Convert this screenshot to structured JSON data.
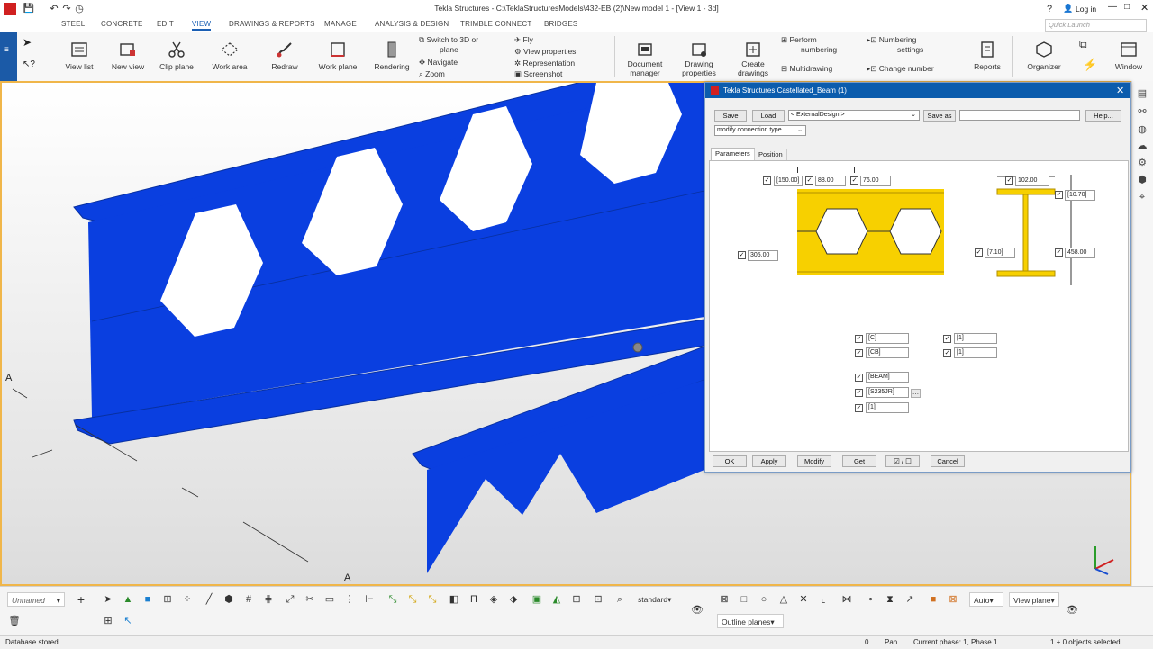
{
  "window": {
    "title": "Tekla Structures - C:\\TeklaStructuresModels\\432-EB (2)\\New model 1  - [View 1 - 3d]",
    "login": "Log in",
    "quick_launch_placeholder": "Quick Launch"
  },
  "menu": [
    "STEEL",
    "CONCRETE",
    "EDIT",
    "VIEW",
    "DRAWINGS & REPORTS",
    "MANAGE",
    "ANALYSIS & DESIGN",
    "TRIMBLE CONNECT",
    "BRIDGES"
  ],
  "ribbon": {
    "view_list": "View list",
    "new_view": "New view",
    "clip_plane": "Clip plane",
    "work_area": "Work area",
    "redraw": "Redraw",
    "work_plane": "Work plane",
    "rendering": "Rendering",
    "switch_3d": "Switch to 3D or",
    "switch_3d_2": "plane",
    "navigate": "Navigate",
    "zoom": "Zoom",
    "fly": "Fly",
    "view_properties": "View properties",
    "representation": "Representation",
    "screenshot": "Screenshot",
    "document_manager": "Document",
    "document_manager_2": "manager",
    "drawing_properties": "Drawing",
    "drawing_properties_2": "properties",
    "create_drawings": "Create",
    "create_drawings_2": "drawings",
    "perform_numbering": "Perform",
    "perform_numbering_2": "numbering",
    "multidrawing": "Multidrawing",
    "numbering_settings": "Numbering",
    "numbering_settings_2": "settings",
    "change_number": "Change number",
    "reports": "Reports",
    "organizer": "Organizer",
    "window": "Window"
  },
  "viewport": {
    "gridlabel_a1": "A",
    "gridlabel_a2": "A"
  },
  "dialog": {
    "title": "Tekla Structures  Castellated_Beam (1)",
    "save": "Save",
    "load": "Load",
    "preset": "< ExternalDesign >",
    "save_as": "Save as",
    "help": "Help...",
    "modify_type": "modify connection type",
    "tab_parameters": "Parameters",
    "tab_position": "Position",
    "p1": "[150.00]",
    "p2": "88.00",
    "p3": "76.00",
    "p4": "305.00",
    "p5": "102.00",
    "p6": "[10.70]",
    "p7": "[7.10]",
    "p8": "458.00",
    "f1": "[C]",
    "f2": "[1]",
    "f3": "[CB]",
    "f4": "[1]",
    "name": "[BEAM]",
    "material": "[S235JR]",
    "class": "[1]",
    "ok": "OK",
    "apply": "Apply",
    "modify": "Modify",
    "get": "Get",
    "toggle": "☑ / ☐",
    "cancel": "Cancel"
  },
  "bottom": {
    "phase_select": "Unnamed",
    "standard": "standard",
    "auto": "Auto",
    "view_plane": "View plane",
    "outline_planes": "Outline planes"
  },
  "status": {
    "left": "Database stored",
    "zero": "0",
    "mode": "Pan",
    "phase": "Current phase: 1, Phase 1",
    "selection": "1 + 0 objects selected"
  },
  "colors": {
    "beam": "#0a3fe0",
    "accent": "#1b5aa7",
    "yellow": "#f7d000"
  }
}
